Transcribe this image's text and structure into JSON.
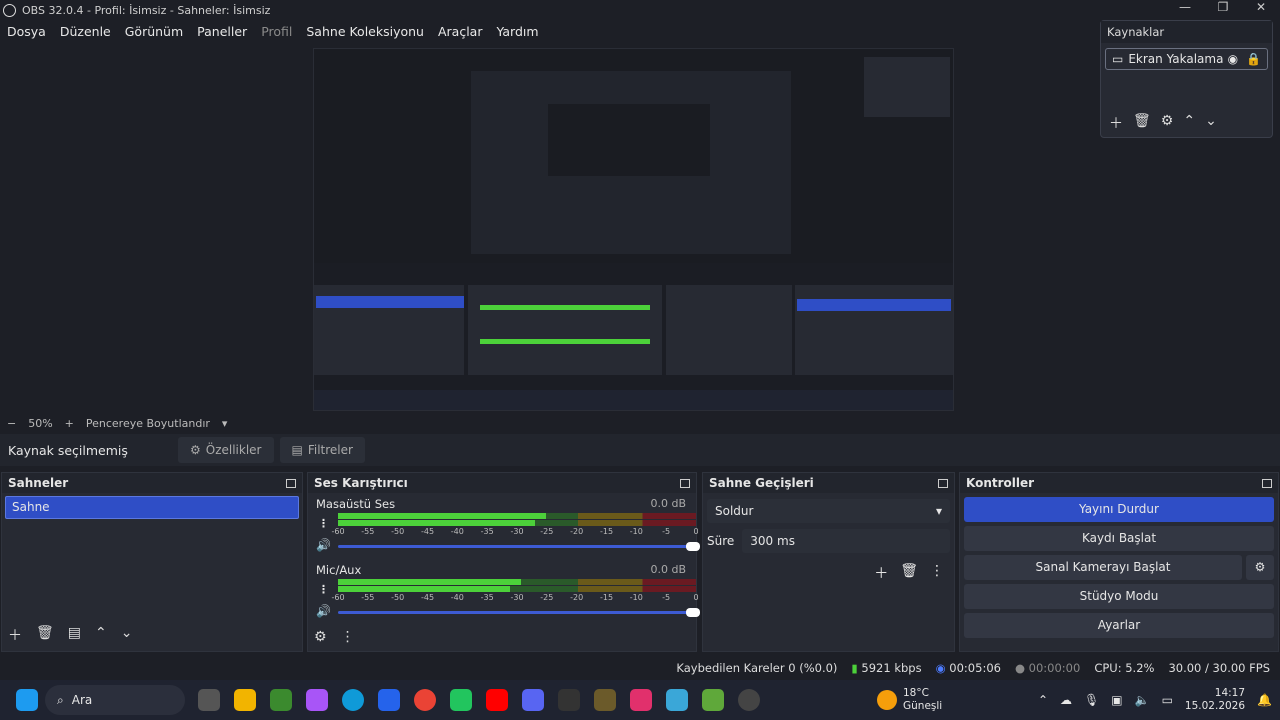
{
  "window": {
    "title": "OBS 32.0.4 - Profil: İsimsiz - Sahneler: İsimsiz",
    "minimize": "—",
    "maximize": "❐",
    "close": "✕"
  },
  "menu": [
    "Dosya",
    "Düzenle",
    "Görünüm",
    "Paneller",
    "Profil",
    "Sahne Koleksiyonu",
    "Araçlar",
    "Yardım"
  ],
  "sources": {
    "title": "Kaynaklar",
    "item": "Ekran Yakalama"
  },
  "zoom": {
    "minus": "−",
    "value": "50%",
    "plus": "+",
    "mode": "Pencereye Boyutlandır"
  },
  "source_bar": {
    "none": "Kaynak seçilmemiş",
    "properties": "Özellikler",
    "filters": "Filtreler"
  },
  "scenes": {
    "title": "Sahneler",
    "items": [
      "Sahne"
    ]
  },
  "mixer": {
    "title": "Ses Karıştırıcı",
    "channels": [
      {
        "name": "Masaüstü Ses",
        "db": "0.0 dB",
        "level": 0.58
      },
      {
        "name": "Mic/Aux",
        "db": "0.0 dB",
        "level": 0.51
      }
    ],
    "scale": [
      "-60",
      "-55",
      "-50",
      "-45",
      "-40",
      "-35",
      "-30",
      "-25",
      "-20",
      "-15",
      "-10",
      "-5",
      "0"
    ]
  },
  "transitions": {
    "title": "Sahne Geçişleri",
    "type": "Soldur",
    "duration_label": "Süre",
    "duration": "300 ms"
  },
  "controls": {
    "title": "Kontroller",
    "stream": "Yayını Durdur",
    "record": "Kaydı Başlat",
    "vcam": "Sanal Kamerayı Başlat",
    "studio": "Stüdyo Modu",
    "settings": "Ayarlar"
  },
  "status": {
    "dropped": "Kaybedilen Kareler 0 (%0.0)",
    "kbps": "5921 kbps",
    "stream_time": "00:05:06",
    "rec_time": "00:00:00",
    "cpu": "CPU: 5.2%",
    "fps": "30.00 / 30.00 FPS"
  },
  "taskbar": {
    "search": "Ara",
    "weather_temp": "18°C",
    "weather_desc": "Güneşli",
    "time": "14:17",
    "date": "15.02.2026"
  },
  "colors": {
    "accent": "#2f4ec6",
    "meter_green": "#4cd13a",
    "bg": "#1d1f26"
  }
}
